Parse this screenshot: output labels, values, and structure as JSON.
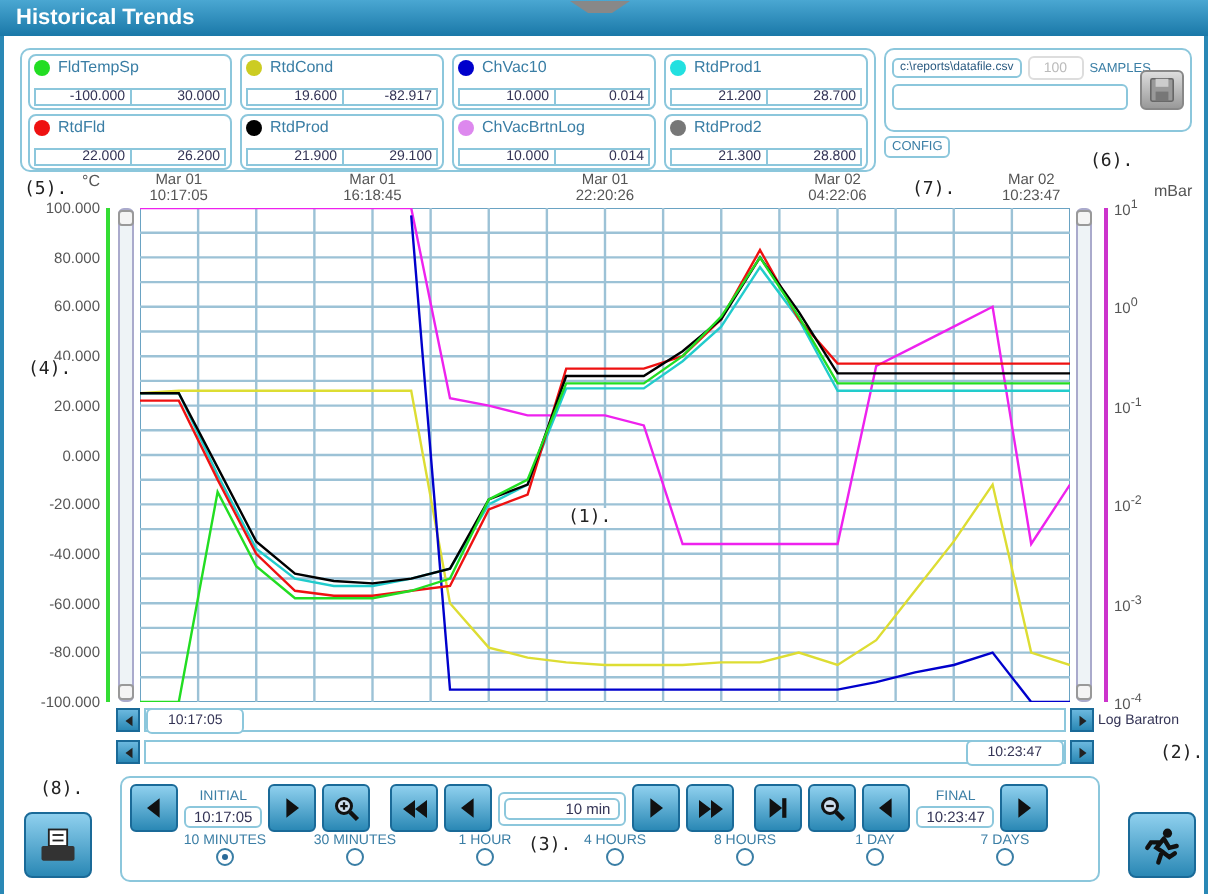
{
  "window": {
    "title": "Historical Trends"
  },
  "channels": [
    {
      "name": "FldTempSp",
      "color": "#22dd22",
      "min": "-100.000",
      "max": "30.000"
    },
    {
      "name": "RtdCond",
      "color": "#cccc22",
      "min": "19.600",
      "max": "-82.917"
    },
    {
      "name": "ChVac10",
      "color": "#0000cc",
      "min": "10.000",
      "max": "0.014"
    },
    {
      "name": "RtdProd1",
      "color": "#22e0e0",
      "min": "21.200",
      "max": "28.700"
    },
    {
      "name": "RtdFld",
      "color": "#ee1111",
      "min": "22.000",
      "max": "26.200"
    },
    {
      "name": "RtdProd",
      "color": "#000000",
      "min": "21.900",
      "max": "29.100"
    },
    {
      "name": "ChVacBrtnLog",
      "color": "#dd88ee",
      "min": "10.000",
      "max": "0.014"
    },
    {
      "name": "RtdProd2",
      "color": "#777777",
      "min": "21.300",
      "max": "28.800"
    }
  ],
  "file": {
    "path": "c:\\reports\\datafile.csv",
    "samples": {
      "placeholder": "100"
    },
    "samples_label": "SAMPLES",
    "config_button": "CONFIG"
  },
  "callouts": [
    "(1).",
    "(2).",
    "(3).",
    "(4).",
    "(5).",
    "(6).",
    "(7).",
    "(8)."
  ],
  "trend": {
    "left_unit": "°C",
    "chart_data": {
      "type": "line",
      "grid": true,
      "ylim": [
        -100,
        100
      ],
      "categories": [
        null,
        "Mar 01 10:17:05",
        null,
        null,
        null,
        null,
        "Mar 01 16:18:45",
        null,
        null,
        null,
        null,
        null,
        "Mar 01 22:20:26",
        null,
        null,
        null,
        null,
        null,
        "Mar 02 04:22:06",
        null,
        null,
        null,
        null,
        "Mar 02 10:23:47",
        null
      ],
      "yticks": [
        {
          "value": 100,
          "label": "100.000"
        },
        {
          "value": 80,
          "label": "80.000"
        },
        {
          "value": 60,
          "label": "60.000"
        },
        {
          "value": 40,
          "label": "40.000"
        },
        {
          "value": 20,
          "label": "20.000"
        },
        {
          "value": 0,
          "label": "0.000"
        },
        {
          "value": -20,
          "label": "-20.000"
        },
        {
          "value": -40,
          "label": "-40.000"
        },
        {
          "value": -60,
          "label": "-60.000"
        },
        {
          "value": -80,
          "label": "-80.000"
        },
        {
          "value": -100,
          "label": "-100.000"
        }
      ],
      "series": [
        {
          "color": "#dddd33",
          "values": [
            25,
            26,
            26,
            26,
            26,
            26,
            26,
            26,
            -60,
            -78,
            -82,
            -84,
            -85,
            -85,
            -85,
            -84,
            -84,
            -80,
            -85,
            -75,
            -55,
            -35,
            -12,
            -80,
            -85
          ]
        },
        {
          "color": "#ee22ee",
          "values": [
            100,
            100,
            100,
            100,
            100,
            100,
            100,
            100,
            23,
            20,
            16,
            16,
            16,
            12,
            -36,
            -36,
            -36,
            -36,
            -36,
            36,
            44,
            52,
            60,
            -36,
            -12
          ]
        },
        {
          "color": "#0000cc",
          "values": [
            null,
            null,
            null,
            null,
            null,
            null,
            null,
            97,
            -95,
            -95,
            -95,
            -95,
            -95,
            -95,
            -95,
            -95,
            -95,
            -95,
            -95,
            -92,
            -88,
            -85,
            -80,
            -100,
            -100
          ]
        },
        {
          "color": "#22cccc",
          "values": [
            25,
            25,
            -8,
            -38,
            -50,
            -53,
            -53,
            -50,
            -46,
            -20,
            -12,
            27,
            27,
            27,
            38,
            52,
            76,
            55,
            26,
            26,
            26,
            26,
            26,
            26,
            26
          ]
        },
        {
          "color": "#ee1111",
          "values": [
            22,
            22,
            -10,
            -40,
            -55,
            -57,
            -57,
            -55,
            -53,
            -22,
            -16,
            35,
            35,
            35,
            40,
            55,
            83,
            55,
            37,
            37,
            37,
            37,
            37,
            37,
            37
          ]
        },
        {
          "color": "#000000",
          "values": [
            25,
            25,
            -5,
            -35,
            -48,
            -51,
            -52,
            -50,
            -46,
            -18,
            -12,
            32,
            32,
            32,
            42,
            55,
            80,
            58,
            33,
            33,
            33,
            33,
            33,
            33,
            33
          ]
        },
        {
          "color": "#22dd22",
          "values": [
            -100,
            -100,
            -15,
            -45,
            -58,
            -58,
            -58,
            -55,
            -50,
            -18,
            -10,
            29,
            29,
            29,
            40,
            56,
            80,
            56,
            29,
            29,
            29,
            29,
            29,
            29,
            29
          ]
        }
      ]
    }
  },
  "log_axis": {
    "unit": "mBar",
    "tick_labels": [
      "10$^{1}$",
      "10$^{0}$",
      "10$^{-1}$",
      "10$^{-2}$",
      "10$^{-3}$",
      "10$^{-4}$"
    ]
  },
  "scroll": {
    "start": "10:17:05",
    "end": "10:23:47",
    "log_channel": "Log Baratron"
  },
  "controls": {
    "initial": {
      "label": "INITIAL",
      "value": "10:17:05"
    },
    "span": "10 min",
    "final": {
      "label": "FINAL",
      "value": "10:23:47"
    },
    "ranges": [
      {
        "label": "10 MINUTES",
        "selected": true
      },
      {
        "label": "30 MINUTES",
        "selected": false
      },
      {
        "label": "1 HOUR",
        "selected": false
      },
      {
        "label": "4 HOURS",
        "selected": false
      },
      {
        "label": "8 HOURS",
        "selected": false
      },
      {
        "label": "1 DAY",
        "selected": false
      },
      {
        "label": "7 DAYS",
        "selected": false
      }
    ]
  }
}
